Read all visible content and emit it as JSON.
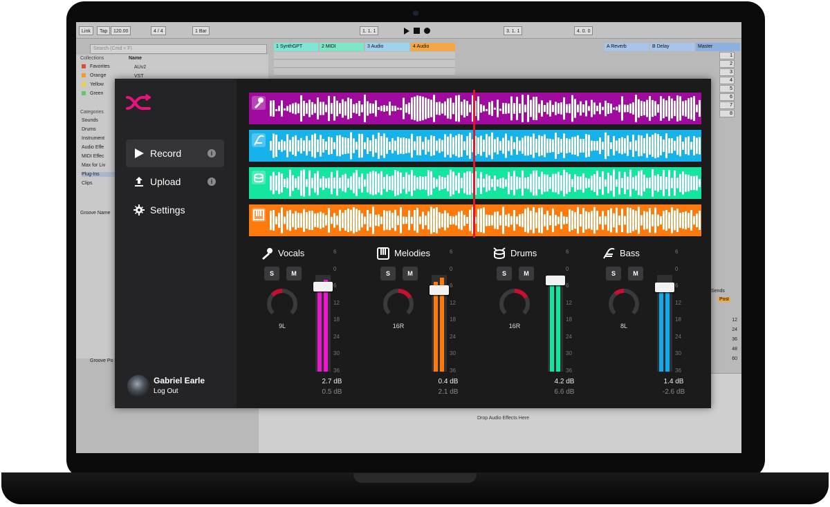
{
  "daw": {
    "link": "Link",
    "tap": "Tap",
    "tempo": "120.00",
    "signature": "4 / 4",
    "quantize": "1 Bar",
    "position": "1.  1.  1",
    "position2": "3.  1.  1",
    "loop_length": "4.  0.  0",
    "search_placeholder": "Search (Cmd + F)",
    "collections_label": "Collections",
    "collections": [
      {
        "name": "Favorites",
        "color": "#d94b3b"
      },
      {
        "name": "Orange",
        "color": "#f29a2e"
      },
      {
        "name": "Yellow",
        "color": "#e8d43a"
      },
      {
        "name": "Green",
        "color": "#6ec46b"
      }
    ],
    "categories_label": "Categories",
    "categories": [
      "Sounds",
      "Drums",
      "Instrument",
      "Audio Effe",
      "MIDI Effec",
      "Max for Liv",
      "Plug-Ins",
      "Clips"
    ],
    "name_col": "Name",
    "files": [
      "AUv2",
      "VST"
    ],
    "groove_name": "Groove Name",
    "groove_pool": "Groove Po",
    "tracks": [
      {
        "label": "1 SynthGPT",
        "color": "#7ee6d6"
      },
      {
        "label": "2 MIDI",
        "color": "#7ee6c8"
      },
      {
        "label": "3 Audio",
        "color": "#9fd2ee"
      },
      {
        "label": "4 Audio",
        "color": "#f3a845"
      },
      {
        "label": "A Reverb",
        "color": "#a8c4ea"
      },
      {
        "label": "B Delay",
        "color": "#a8c4ea"
      },
      {
        "label": "Master",
        "color": "#8cb0e0"
      }
    ],
    "scene_numbers": [
      "1",
      "2",
      "3",
      "4",
      "5",
      "6",
      "7",
      "8"
    ],
    "drop_text": "Drop Audio Effects Here",
    "sends": "Sends",
    "post": "Post",
    "meter_scale": [
      "12",
      "24",
      "36",
      "48",
      "60"
    ]
  },
  "plugin": {
    "nav": [
      {
        "label": "Record",
        "info": "i"
      },
      {
        "label": "Upload",
        "info": "i"
      },
      {
        "label": "Settings"
      }
    ],
    "user": {
      "name": "Gabriel Earle",
      "logout": "Log Out"
    },
    "lanes": [
      {
        "name": "vocals",
        "color": "#a00a9e",
        "icon": "microphone-icon"
      },
      {
        "name": "melodies",
        "color": "#15b2ec",
        "icon": "lyre-icon"
      },
      {
        "name": "drums",
        "color": "#14e59f",
        "icon": "drum-icon"
      },
      {
        "name": "bass",
        "color": "#ff7a0c",
        "icon": "piano-icon"
      }
    ],
    "strips": [
      {
        "name": "Vocals",
        "pan": "9L",
        "pan_value": -0.35,
        "level": 0.91,
        "level2": 0.95,
        "fader_value": 0.88,
        "color": "#ea17cc",
        "db": "2.7 dB",
        "db2": "0.5 dB"
      },
      {
        "name": "Melodies",
        "pan": "16R",
        "pan_value": 0.45,
        "level": 0.93,
        "level2": 0.97,
        "fader_value": 0.84,
        "color": "#ff7a0c",
        "db": "0.4 dB",
        "db2": "2.1 dB"
      },
      {
        "name": "Drums",
        "pan": "16R",
        "pan_value": 0.45,
        "level": 0.94,
        "level2": 0.99,
        "fader_value": 0.94,
        "color": "#14e59f",
        "db": "4.2 dB",
        "db2": "6.6 dB"
      },
      {
        "name": "Bass",
        "pan": "8L",
        "pan_value": -0.3,
        "level": 0.89,
        "level2": 0.84,
        "fader_value": 0.87,
        "color": "#14a8ec",
        "db": "1.4 dB",
        "db2": "-2.6 dB"
      }
    ],
    "solo": "S",
    "mute": "M",
    "scale": [
      "6",
      "0",
      "6",
      "12",
      "18",
      "24",
      "30",
      "36"
    ]
  }
}
